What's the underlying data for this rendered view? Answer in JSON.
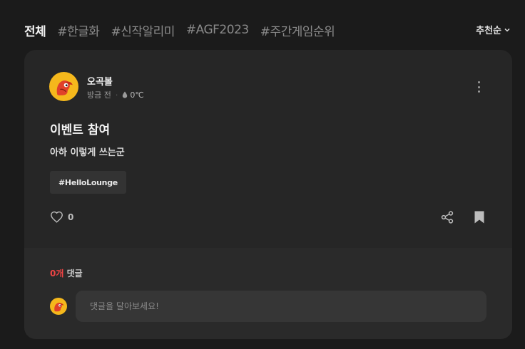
{
  "tabs": [
    {
      "label": "전체",
      "active": true
    },
    {
      "label": "#한글화",
      "active": false
    },
    {
      "label": "#신작알리미",
      "active": false
    },
    {
      "label": "#AGF2023",
      "active": false
    },
    {
      "label": "#주간게임순위",
      "active": false
    }
  ],
  "sort": {
    "label": "추천순",
    "icon": "chevron-down-icon"
  },
  "post": {
    "author": "오곡볼",
    "time": "방금 전",
    "separator": "·",
    "temperature": "0℃",
    "title": "이벤트 참여",
    "body": "아하 이렇게 쓰는군",
    "tag": "#HelloLounge",
    "like_count": "0"
  },
  "comments": {
    "count_number": "0개",
    "count_label": " 댓글",
    "placeholder": "댓글을 달아보세요!"
  },
  "colors": {
    "background": "#1b1b1b",
    "card": "#262626",
    "comment_area": "#2a2a2a",
    "accent_red": "#ef4444",
    "avatar_yellow": "#f5b81c"
  }
}
